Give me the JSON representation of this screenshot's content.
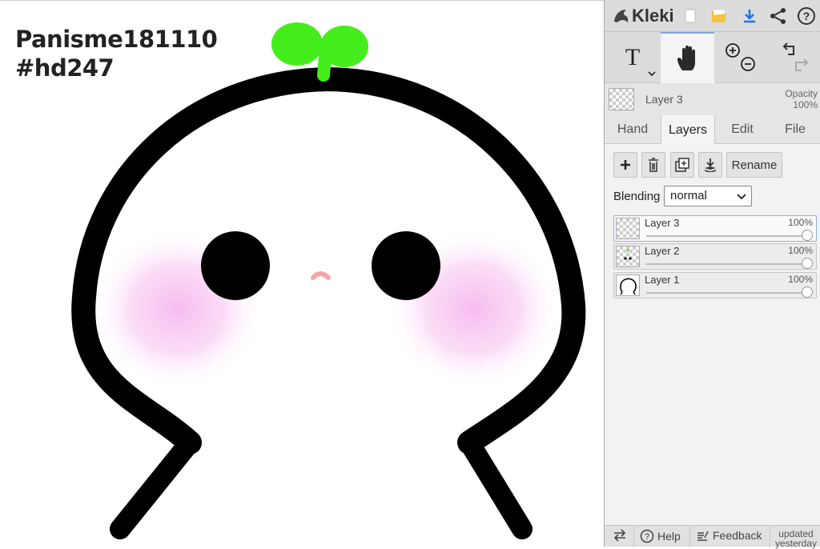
{
  "canvas": {
    "watermark_line1": "Panisme181110",
    "watermark_line2": "#hd247"
  },
  "app": {
    "name": "Kleki"
  },
  "toolbar": {
    "icons": [
      "new-file-icon",
      "open-folder-icon",
      "download-icon",
      "share-icon",
      "help-icon"
    ]
  },
  "tools": {
    "text_label": "T",
    "items": [
      "text-tool",
      "hand-tool",
      "zoom-tool",
      "undo-redo"
    ]
  },
  "current_layer": {
    "name": "Layer 3",
    "opacity_label": "Opacity",
    "opacity_value": "100%"
  },
  "tabs": [
    "Hand",
    "Layers",
    "Edit",
    "File"
  ],
  "active_tab": "Layers",
  "layers_panel": {
    "rename_label": "Rename",
    "blending_label": "Blending",
    "blending_value": "normal",
    "layers": [
      {
        "name": "Layer 3",
        "opacity": "100%",
        "selected": true
      },
      {
        "name": "Layer 2",
        "opacity": "100%",
        "selected": false
      },
      {
        "name": "Layer 1",
        "opacity": "100%",
        "selected": false
      }
    ]
  },
  "footer": {
    "help": "Help",
    "feedback": "Feedback",
    "updated_line1": "updated",
    "updated_line2": "yesterday"
  },
  "colors": {
    "accent": "#1a73e8",
    "folder": "#f2b418",
    "sprout": "#44ee1c",
    "blush": "#f6c0ef"
  }
}
